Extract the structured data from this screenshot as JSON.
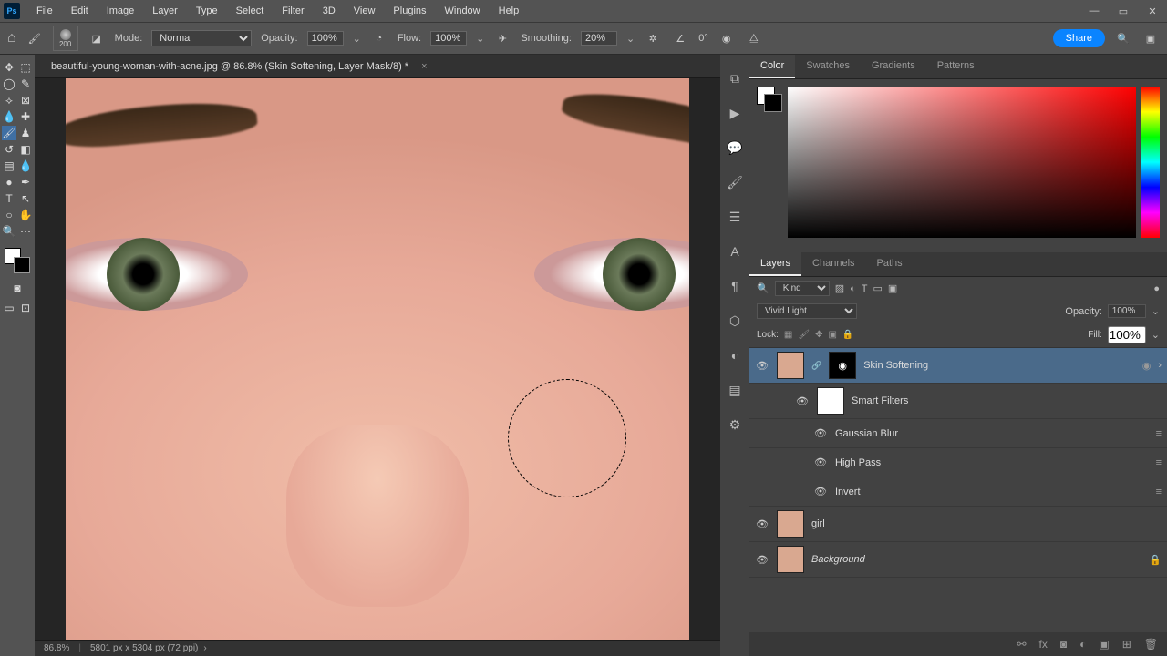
{
  "menu": {
    "items": [
      "File",
      "Edit",
      "Image",
      "Layer",
      "Type",
      "Select",
      "Filter",
      "3D",
      "View",
      "Plugins",
      "Window",
      "Help"
    ]
  },
  "options": {
    "brush_size": "200",
    "mode_label": "Mode:",
    "mode_value": "Normal",
    "opacity_label": "Opacity:",
    "opacity_value": "100%",
    "flow_label": "Flow:",
    "flow_value": "100%",
    "smoothing_label": "Smoothing:",
    "smoothing_value": "20%",
    "angle_value": "0°",
    "share_label": "Share"
  },
  "document": {
    "tab_title": "beautiful-young-woman-with-acne.jpg @ 86.8% (Skin Softening, Layer Mask/8) *",
    "zoom": "86.8%",
    "dimensions": "5801 px x 5304 px (72 ppi)"
  },
  "panels": {
    "color_tabs": [
      "Color",
      "Swatches",
      "Gradients",
      "Patterns"
    ],
    "layer_tabs": [
      "Layers",
      "Channels",
      "Paths"
    ]
  },
  "layers": {
    "filter_kind": "Kind",
    "blend_mode": "Vivid Light",
    "opacity_label": "Opacity:",
    "opacity_value": "100%",
    "lock_label": "Lock:",
    "fill_label": "Fill:",
    "fill_value": "100%",
    "items": [
      {
        "name": "Skin Softening"
      },
      {
        "name": "Smart Filters"
      },
      {
        "name": "Gaussian Blur"
      },
      {
        "name": "High Pass"
      },
      {
        "name": "Invert"
      },
      {
        "name": "girl"
      },
      {
        "name": "Background"
      }
    ]
  }
}
